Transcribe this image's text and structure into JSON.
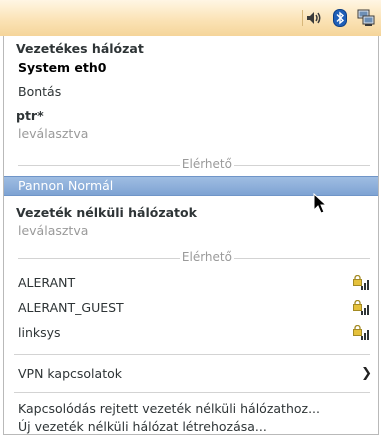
{
  "panel": {
    "icons": [
      "volume-icon",
      "bluetooth-icon",
      "network-icon"
    ]
  },
  "menu": {
    "wired_header": "Vezetékes hálózat",
    "wired_device": "System eth0",
    "wired_disconnect": "Bontás",
    "ptr_header": "ptr*",
    "ptr_status": "leválasztva",
    "available_label_1": "Elérhető",
    "selected_network": "Pannon Normál",
    "wireless_header": "Vezeték nélküli hálózatok",
    "wireless_status": "leválasztva",
    "available_label_2": "Elérhető",
    "networks": [
      "ALERANT",
      "ALERANT_GUEST",
      "linksys"
    ],
    "vpn_label": "VPN kapcsolatok",
    "hidden_connect": "Kapcsolódás rejtett vezeték nélküli hálózathoz...",
    "new_wireless": "Új vezeték nélküli hálózat létrehozása..."
  },
  "colors": {
    "panel_top": "#fff6e4",
    "panel_bottom": "#f5d59a",
    "selection": "#8aaed9",
    "dim_text": "#9a9a9a"
  }
}
